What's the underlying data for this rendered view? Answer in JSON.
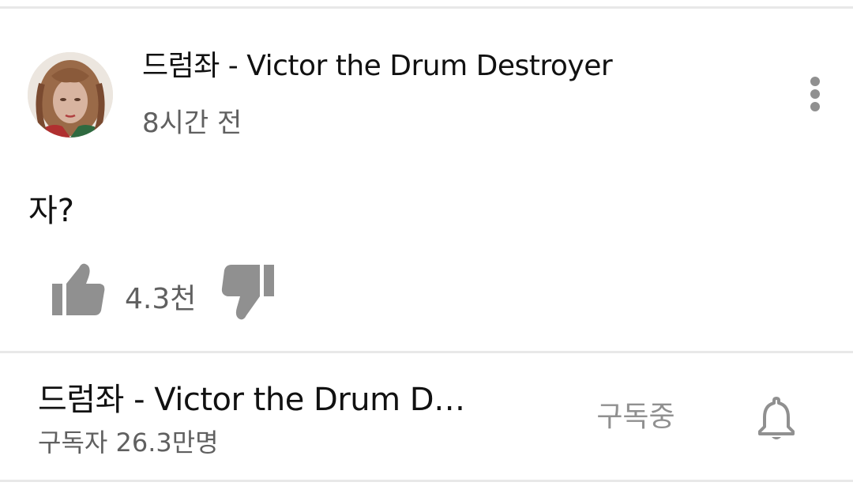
{
  "post": {
    "author": "드럼좌 - Victor the Drum Destroyer",
    "time": "8시간 전",
    "text": "자?",
    "like_count": "4.3천",
    "icons": {
      "avatar": "avatar",
      "menu": "more-vert-icon",
      "like": "thumb-up-icon",
      "dislike": "thumb-down-icon"
    }
  },
  "channel": {
    "name": "드럼좌 - Victor the Drum Destroyer",
    "subscribers": "구독자 26.3만명",
    "subscribe_label": "구독중",
    "icons": {
      "bell": "bell-icon"
    }
  },
  "colors": {
    "primary_text": "#111111",
    "secondary_text": "#606060",
    "icon_gray": "#909090",
    "divider": "#e8e8e8"
  }
}
